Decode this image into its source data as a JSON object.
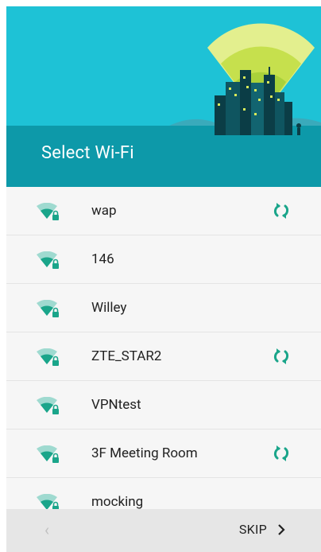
{
  "header": {
    "title": "Select Wi-Fi"
  },
  "networks": [
    {
      "ssid": "wap",
      "wps": true
    },
    {
      "ssid": "146",
      "wps": false
    },
    {
      "ssid": "Willey",
      "wps": false
    },
    {
      "ssid": "ZTE_STAR2",
      "wps": true
    },
    {
      "ssid": "VPNtest",
      "wps": false
    },
    {
      "ssid": "3F Meeting Room",
      "wps": true
    },
    {
      "ssid": "mocking",
      "wps": false
    }
  ],
  "footer": {
    "back_icon": "chevron-left-icon",
    "skip_label": "SKIP",
    "skip_icon": "chevron-right-icon"
  },
  "colors": {
    "header": "#1ec2d6",
    "header_band": "#0d99a9",
    "accent": "#1aa58a",
    "wifi_light": "#9fdad0"
  }
}
